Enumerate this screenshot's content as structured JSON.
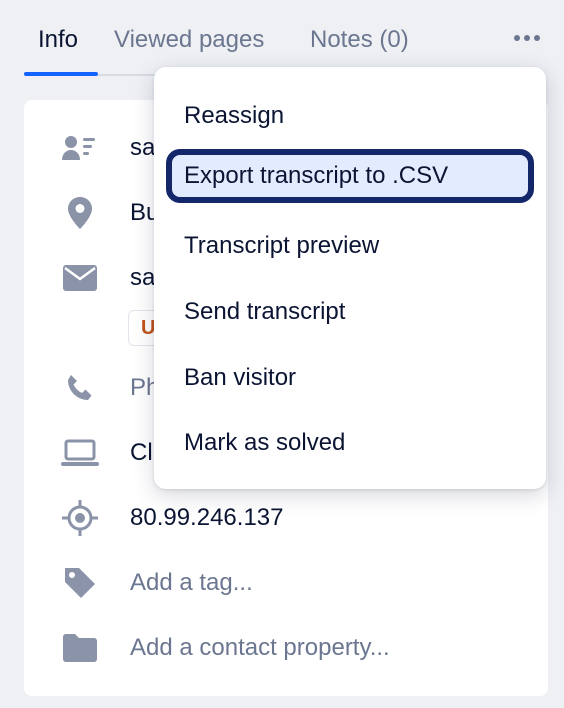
{
  "tabs": [
    {
      "label": "Info",
      "active": true
    },
    {
      "label": "Viewed pages",
      "active": false
    },
    {
      "label": "Notes (0)",
      "active": false
    }
  ],
  "colors": {
    "accent": "#1463ff",
    "focus_ring": "#14276b",
    "focus_bg": "#e3ebff",
    "badge_text": "#c2541a"
  },
  "details": [
    {
      "icon": "contact-card-icon",
      "value": "sa"
    },
    {
      "icon": "location-pin-icon",
      "value": "Bu"
    },
    {
      "icon": "envelope-icon",
      "value": "sa"
    },
    {
      "icon": "phone-icon",
      "value": "Ph"
    },
    {
      "icon": "laptop-icon",
      "value": "Cl"
    },
    {
      "icon": "target-icon",
      "value": "80.99.246.137"
    },
    {
      "icon": "tag-icon",
      "value": "Add a tag..."
    },
    {
      "icon": "folder-icon",
      "value": "Add a contact property..."
    }
  ],
  "email_badge": "U",
  "menu": {
    "items": [
      {
        "label": "Reassign"
      },
      {
        "label": "Export transcript to .CSV",
        "focused": true
      },
      {
        "label": "Transcript preview"
      },
      {
        "label": "Send transcript"
      },
      {
        "label": "Ban visitor"
      },
      {
        "label": "Mark as solved"
      }
    ]
  }
}
